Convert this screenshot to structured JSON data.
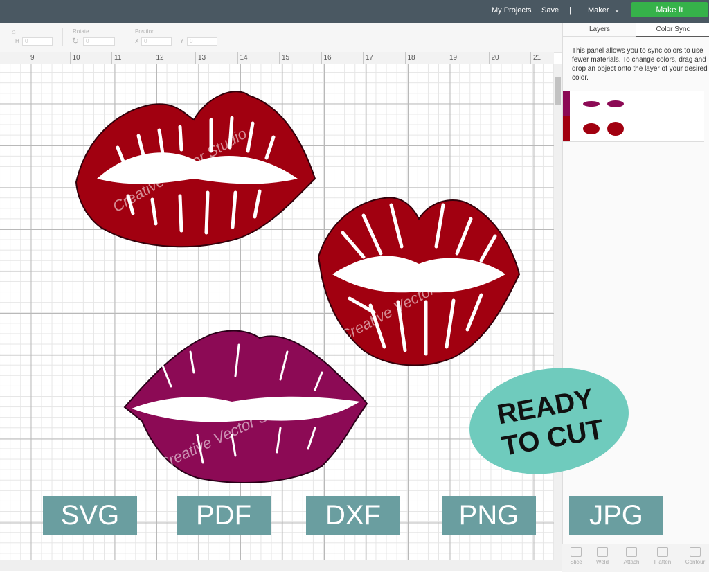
{
  "topbar": {
    "my_projects": "My Projects",
    "save": "Save",
    "separator": "|",
    "machine": "Maker",
    "make_it": "Make It"
  },
  "toolbar": {
    "h_label": "H",
    "rotate_label": "Rotate",
    "position_label": "Position",
    "x_label": "X",
    "y_label": "Y",
    "h_value": "0",
    "rotate_value": "0",
    "x_value": "0",
    "y_value": "0"
  },
  "ruler": {
    "numbers": [
      "9",
      "10",
      "11",
      "12",
      "13",
      "14",
      "15",
      "16",
      "17",
      "18",
      "19",
      "20",
      "21"
    ]
  },
  "panel": {
    "tabs": [
      "Layers",
      "Color Sync"
    ],
    "active_tab": "Color Sync",
    "description": "This panel allows you to sync colors to use fewer materials. To change colors, drag and drop an object onto the layer of your desired color.",
    "layers": [
      {
        "color": "#8c0a55"
      },
      {
        "color": "#a10010"
      }
    ]
  },
  "bottom_tools": [
    "Slice",
    "Weld",
    "Attach",
    "Flatten",
    "Contour"
  ],
  "badge": {
    "line1": "READY",
    "line2": "TO CUT",
    "color": "#6fcbbd"
  },
  "formats": [
    "SVG",
    "PDF",
    "DXF",
    "PNG",
    "JPG"
  ],
  "watermark": "Creative Vector Studio",
  "colors": {
    "red_lips": "#a10010",
    "purple_lips": "#8c0a55",
    "format_bg": "#6a9ea0"
  }
}
